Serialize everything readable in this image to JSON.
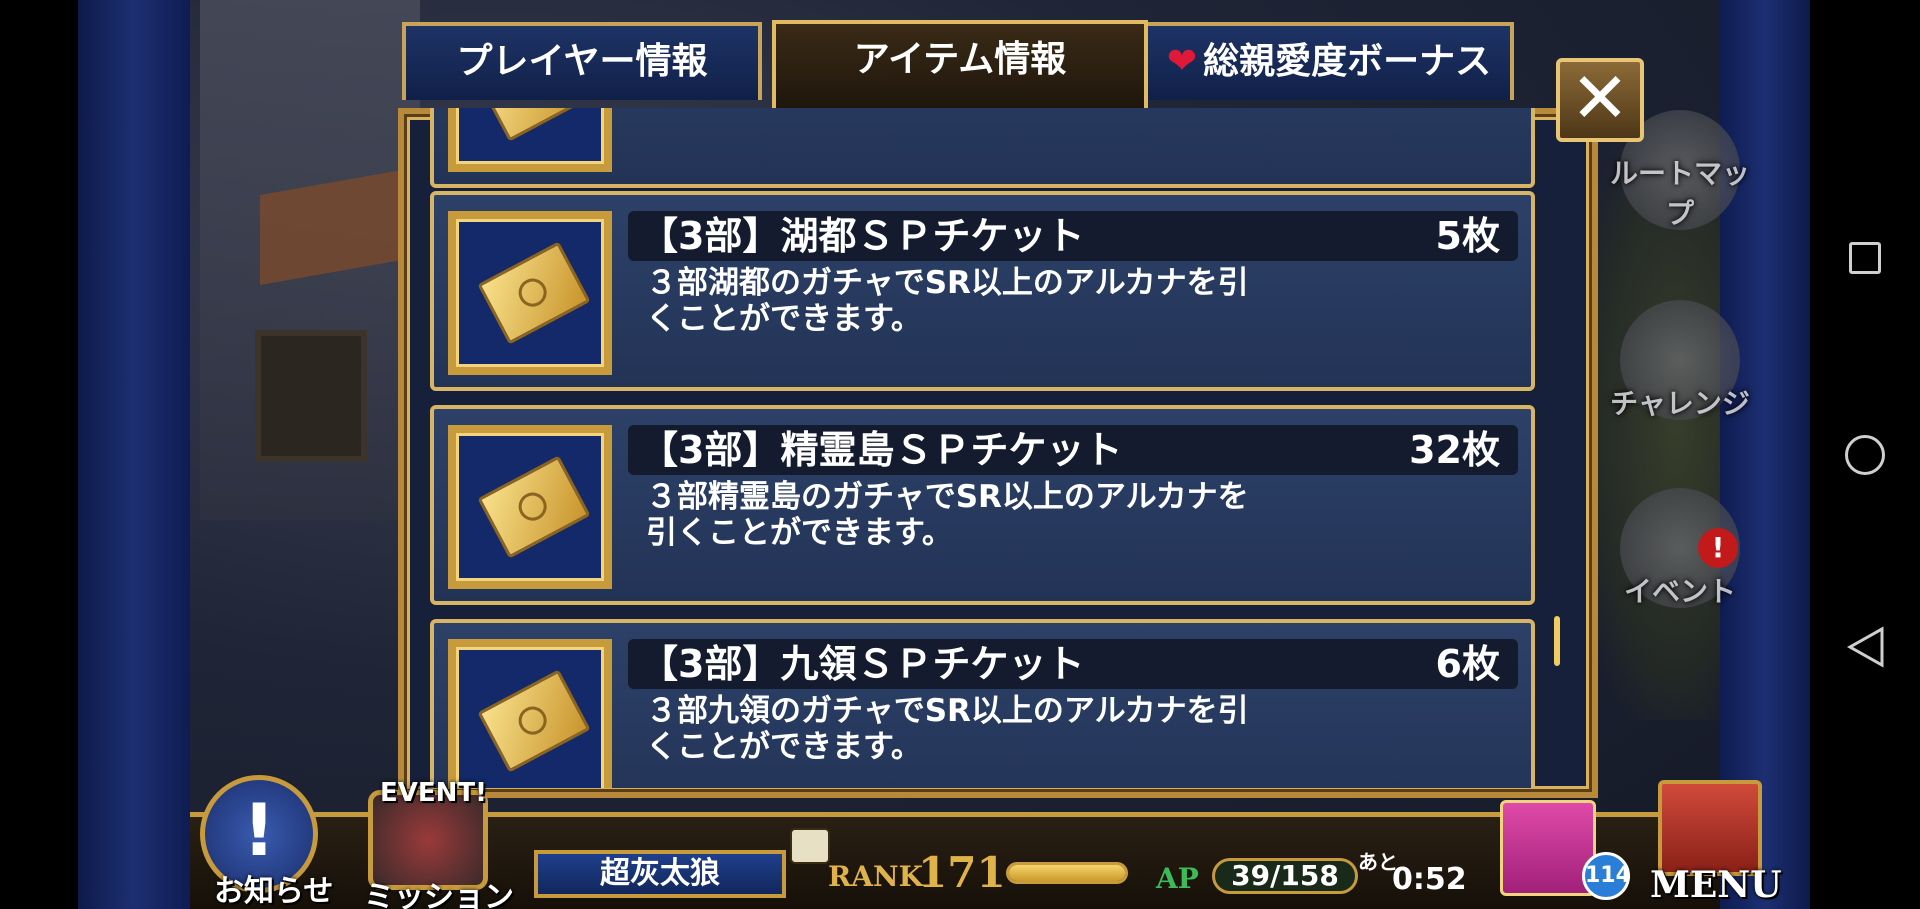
{
  "tabs": {
    "player": "プレイヤー情報",
    "item": "アイテム情報",
    "bonus": "総親愛度ボーナス"
  },
  "close_label": "✕",
  "items": [
    {
      "name": "【3部】湖都ＳＰチケット",
      "count": "5枚",
      "description_line1": "３部湖都のガチャでSR以上のアルカナを引",
      "description_line2": "くことができます。"
    },
    {
      "name": "【3部】精霊島ＳＰチケット",
      "count": "32枚",
      "description_line1": "３部精霊島のガチャでSR以上のアルカナを",
      "description_line2": "引くことができます。"
    },
    {
      "name": "【3部】九領ＳＰチケット",
      "count": "6枚",
      "description_line1": "３部九領のガチャでSR以上のアルカナを引",
      "description_line2": "くことができます。"
    }
  ],
  "side_menu": {
    "route_map": "ルートマップ",
    "challenge": "チャレンジ",
    "event": "イベント",
    "event_alert": "!"
  },
  "bottom": {
    "news": "お知らせ",
    "event_tag": "EVENT!",
    "mission": "ミッション",
    "player_name": "超灰太狼",
    "rank_label": "RANK",
    "rank_value": "171",
    "rank_progress": 1.0,
    "ap_label": "AP",
    "ap_value": "39/158",
    "ato": "あと",
    "time": "0:52",
    "gift_count": "114",
    "menu": "MENU"
  },
  "colors": {
    "gold": "#c79a3c",
    "panel_blue": "#223356",
    "ap_green": "#3dbb58",
    "heart": "#e0193a"
  },
  "icons": [
    "square-nav-icon",
    "circle-nav-icon",
    "back-nav-icon",
    "close-icon",
    "heart-icon",
    "ticket-icon",
    "gift-icon",
    "menu-book-icon",
    "chat-icon",
    "news-icon"
  ]
}
